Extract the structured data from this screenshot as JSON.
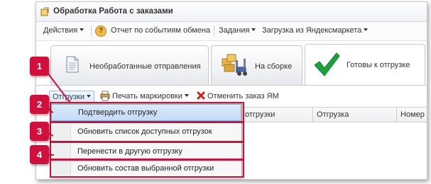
{
  "window": {
    "title": "Обработка  Работа с заказами"
  },
  "menubar": {
    "actions": "Действия",
    "report": "Отчет по событиям обмена",
    "tasks": "Задания",
    "load": "Загрузка из Яндексмаркета",
    "help_glyph": "?"
  },
  "tabs": [
    {
      "label": "Необработанные отправления",
      "icon": "document-icon"
    },
    {
      "label": "На сборке",
      "icon": "forklift-boxes-icon"
    },
    {
      "label": "Готовы к отгрузке",
      "icon": "green-checkmark-icon"
    }
  ],
  "toolbar": {
    "shipments": "Отгрузки",
    "print_labels": "Печать маркировки",
    "cancel_order": "Отменить заказ ЯМ"
  },
  "grid": {
    "columns": [
      "отгрузки",
      "Отгрузка",
      "Номер"
    ]
  },
  "dropdown": {
    "items": [
      "Подтвердить отгрузку",
      "Обновить список доступных отгрузок",
      "Перенести в другую отгрузку",
      "Обновить состав выбранной отгрузки"
    ]
  },
  "callouts": [
    "1",
    "2",
    "3",
    "4"
  ],
  "colors": {
    "callout": "#d0103a",
    "selected_item": "#c4dbf6",
    "check": "#1aa33a"
  }
}
